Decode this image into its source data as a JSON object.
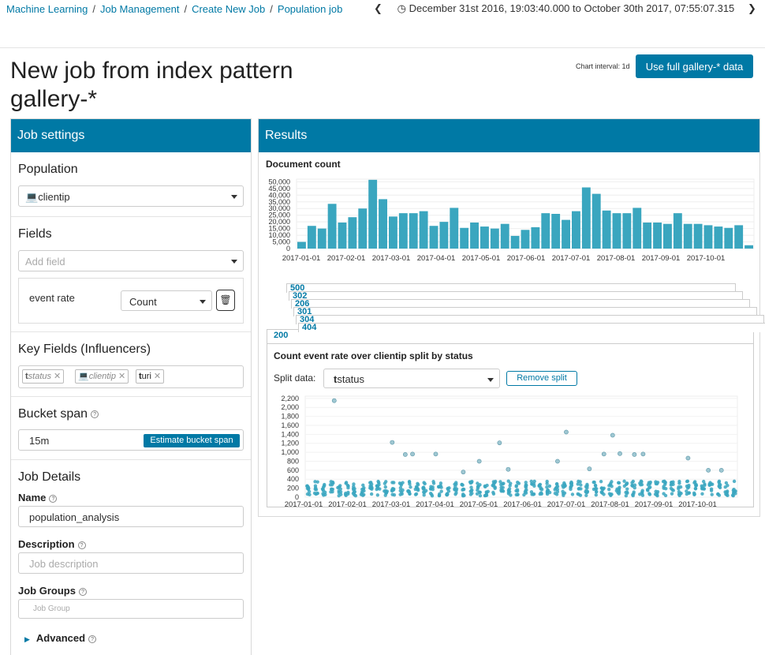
{
  "breadcrumbs": [
    "Machine Learning",
    "Job Management",
    "Create New Job",
    "Population job"
  ],
  "time_range": "December 31st 2016, 19:03:40.000 to October 30th 2017, 07:55:07.315",
  "page_title": "New job from index pattern gallery-*",
  "chart_interval_label": "Chart interval: 1d",
  "use_full_button": "Use full gallery-* data",
  "job_settings": {
    "header": "Job settings",
    "population_title": "Population",
    "population_value": "clientip",
    "fields_title": "Fields",
    "add_field_placeholder": "Add field",
    "field_name": "event rate",
    "field_function": "Count",
    "key_fields_title": "Key Fields (Influencers)",
    "influencers": [
      {
        "label": "status",
        "icon": "t",
        "selected": false
      },
      {
        "label": "clientip",
        "icon": "laptop-icon",
        "selected": false
      },
      {
        "label": "uri",
        "icon": "t",
        "selected": true
      }
    ],
    "bucket_span_title": "Bucket span",
    "bucket_span_value": "15m",
    "estimate_button": "Estimate bucket span",
    "job_details_title": "Job Details",
    "name_label": "Name",
    "name_value": "population_analysis",
    "description_label": "Description",
    "description_placeholder": "Job description",
    "groups_label": "Job Groups",
    "groups_placeholder": "Job Group",
    "advanced_label": "Advanced"
  },
  "results": {
    "header": "Results",
    "doc_count_title": "Document count",
    "split_title": "Count event rate over clientip split by status",
    "split_data_label": "Split data:",
    "split_field": "status",
    "remove_split_button": "Remove split",
    "stacked_cards": [
      "500",
      "302",
      "206",
      "301",
      "304",
      "404",
      "200"
    ]
  },
  "chart_data": [
    {
      "type": "bar",
      "title": "Document count",
      "x_ticks": [
        "2017-01-01",
        "2017-02-01",
        "2017-03-01",
        "2017-04-01",
        "2017-05-01",
        "2017-06-01",
        "2017-07-01",
        "2017-08-01",
        "2017-09-01",
        "2017-10-01"
      ],
      "y_ticks": [
        0,
        5000,
        10000,
        15000,
        20000,
        25000,
        30000,
        35000,
        40000,
        45000,
        50000
      ],
      "ylim": [
        0,
        52000
      ],
      "values": [
        5000,
        17000,
        15000,
        33500,
        19500,
        23500,
        30000,
        51500,
        37000,
        24000,
        26500,
        26500,
        28000,
        17000,
        20000,
        30500,
        15500,
        19500,
        16500,
        15000,
        18500,
        9500,
        14000,
        16000,
        26500,
        26000,
        21500,
        28000,
        45800,
        41000,
        28500,
        26500,
        26500,
        30500,
        19500,
        19500,
        18500,
        26500,
        18500,
        18500,
        17500,
        16500,
        15500,
        17500,
        2500
      ]
    },
    {
      "type": "scatter",
      "title": "Count event rate over clientip split by status",
      "x_ticks": [
        "2017-01-01",
        "2017-02-01",
        "2017-03-01",
        "2017-04-01",
        "2017-05-01",
        "2017-06-01",
        "2017-07-01",
        "2017-08-01",
        "2017-09-01",
        "2017-10-01"
      ],
      "y_ticks": [
        0,
        200,
        400,
        600,
        800,
        1000,
        1200,
        1400,
        1600,
        1800,
        2000,
        2200
      ],
      "ylim": [
        0,
        2250
      ],
      "outliers": [
        {
          "x": "2017-01-21",
          "y": 2150
        },
        {
          "x": "2017-03-02",
          "y": 1220
        },
        {
          "x": "2017-03-11",
          "y": 950
        },
        {
          "x": "2017-03-16",
          "y": 960
        },
        {
          "x": "2017-04-01",
          "y": 960
        },
        {
          "x": "2017-04-20",
          "y": 560
        },
        {
          "x": "2017-05-01",
          "y": 800
        },
        {
          "x": "2017-05-15",
          "y": 1210
        },
        {
          "x": "2017-05-21",
          "y": 620
        },
        {
          "x": "2017-06-24",
          "y": 800
        },
        {
          "x": "2017-06-30",
          "y": 1450
        },
        {
          "x": "2017-07-16",
          "y": 630
        },
        {
          "x": "2017-07-26",
          "y": 960
        },
        {
          "x": "2017-08-01",
          "y": 1380
        },
        {
          "x": "2017-08-06",
          "y": 970
        },
        {
          "x": "2017-08-16",
          "y": 950
        },
        {
          "x": "2017-08-22",
          "y": 960
        },
        {
          "x": "2017-09-22",
          "y": 870
        },
        {
          "x": "2017-10-06",
          "y": 600
        },
        {
          "x": "2017-10-15",
          "y": 600
        }
      ]
    }
  ],
  "colors": {
    "accent": "#0079a5",
    "bar": "#3aa6bf",
    "point": "#3aa6bf"
  }
}
